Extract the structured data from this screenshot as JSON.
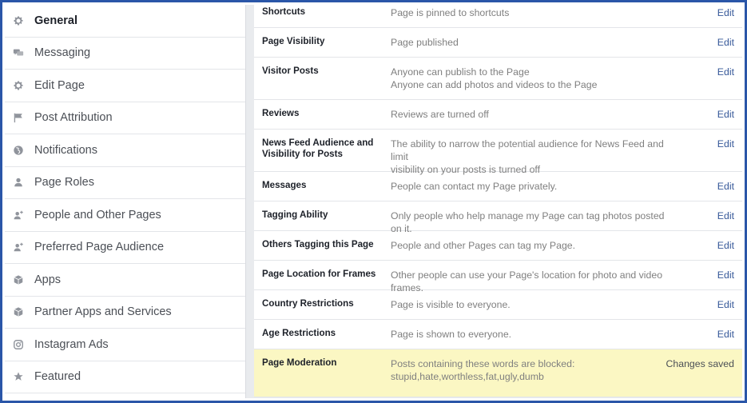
{
  "sidebar": {
    "items": [
      {
        "label": "General",
        "icon": "gear-icon",
        "active": true
      },
      {
        "label": "Messaging",
        "icon": "chat-bubbles-icon"
      },
      {
        "label": "Edit Page",
        "icon": "gear-icon"
      },
      {
        "label": "Post Attribution",
        "icon": "flag-icon"
      },
      {
        "label": "Notifications",
        "icon": "globe-icon"
      },
      {
        "label": "Page Roles",
        "icon": "person-icon"
      },
      {
        "label": "People and Other Pages",
        "icon": "person-add-icon"
      },
      {
        "label": "Preferred Page Audience",
        "icon": "person-add-icon"
      },
      {
        "label": "Apps",
        "icon": "cube-icon"
      },
      {
        "label": "Partner Apps and Services",
        "icon": "cube-icon"
      },
      {
        "label": "Instagram Ads",
        "icon": "instagram-icon"
      },
      {
        "label": "Featured",
        "icon": "star-icon"
      }
    ]
  },
  "settings": {
    "edit_label": "Edit",
    "rows": [
      {
        "name": "Shortcuts",
        "desc": [
          "Page is pinned to shortcuts"
        ],
        "action": "Edit"
      },
      {
        "name": "Page Visibility",
        "desc": [
          "Page published"
        ],
        "action": "Edit"
      },
      {
        "name": "Visitor Posts",
        "desc": [
          "Anyone can publish to the Page",
          "Anyone can add photos and videos to the Page"
        ],
        "action": "Edit"
      },
      {
        "name": "Reviews",
        "desc": [
          "Reviews are turned off"
        ],
        "action": "Edit"
      },
      {
        "name": "News Feed Audience and Visibility for Posts",
        "desc": [
          "The ability to narrow the potential audience for News Feed and limit",
          "visibility on your posts is turned off"
        ],
        "action": "Edit"
      },
      {
        "name": "Messages",
        "desc": [
          "People can contact my Page privately."
        ],
        "action": "Edit"
      },
      {
        "name": "Tagging Ability",
        "desc": [
          "Only people who help manage my Page can tag photos posted on it."
        ],
        "action": "Edit"
      },
      {
        "name": "Others Tagging this Page",
        "desc": [
          "People and other Pages can tag my Page."
        ],
        "action": "Edit"
      },
      {
        "name": "Page Location for Frames",
        "desc": [
          "Other people can use your Page's location for photo and video frames."
        ],
        "action": "Edit"
      },
      {
        "name": "Country Restrictions",
        "desc": [
          "Page is visible to everyone."
        ],
        "action": "Edit"
      },
      {
        "name": "Age Restrictions",
        "desc": [
          "Page is shown to everyone."
        ],
        "action": "Edit"
      },
      {
        "name": "Page Moderation",
        "desc": [
          "Posts containing these words are blocked:",
          "stupid,hate,worthless,fat,ugly,dumb"
        ],
        "status": "Changes saved",
        "highlight": true
      }
    ]
  },
  "colors": {
    "frame": "#2a56a8",
    "link": "#365899",
    "highlight": "#fbf7c3",
    "background": "#e9ebee"
  }
}
